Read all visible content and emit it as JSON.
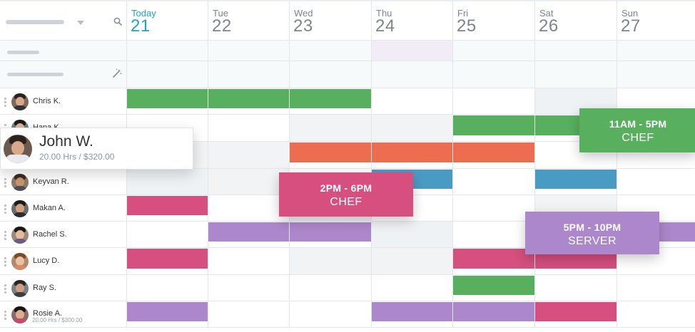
{
  "days": [
    {
      "name": "Today",
      "num": "21",
      "today": true
    },
    {
      "name": "Tue",
      "num": "22"
    },
    {
      "name": "Wed",
      "num": "23"
    },
    {
      "name": "Thu",
      "num": "24"
    },
    {
      "name": "Fri",
      "num": "25"
    },
    {
      "name": "Sat",
      "num": "26"
    },
    {
      "name": "Sun",
      "num": "27"
    }
  ],
  "employees": [
    {
      "name": "Chris K.",
      "sub": ""
    },
    {
      "name": "Hana K.",
      "sub": ""
    },
    {
      "name": "John W.",
      "sub": ""
    },
    {
      "name": "Keyvan R.",
      "sub": ""
    },
    {
      "name": "Makan A.",
      "sub": ""
    },
    {
      "name": "Rachel S.",
      "sub": ""
    },
    {
      "name": "Lucy D.",
      "sub": ""
    },
    {
      "name": "Ray S.",
      "sub": ""
    },
    {
      "name": "Rosie A.",
      "sub": "20.00 Hrs / $300.00"
    }
  ],
  "colors": {
    "green": "#58b05e",
    "orange": "#ec6d50",
    "blue": "#4a9bc4",
    "pink": "#d64f7e",
    "purple": "#ad87cb",
    "today": "#1fa3c8"
  },
  "shifts": [
    {
      "employee": 0,
      "days": [
        0,
        1,
        2
      ],
      "color": "green"
    },
    {
      "employee": 1,
      "days": [
        4,
        5,
        6
      ],
      "color": "green"
    },
    {
      "employee": 2,
      "days": [
        2,
        3,
        4
      ],
      "color": "orange"
    },
    {
      "employee": 3,
      "days": [
        3
      ],
      "color": "blue"
    },
    {
      "employee": 3,
      "days": [
        5
      ],
      "color": "blue"
    },
    {
      "employee": 4,
      "days": [
        0
      ],
      "color": "pink"
    },
    {
      "employee": 5,
      "days": [
        1,
        2
      ],
      "color": "purple"
    },
    {
      "employee": 5,
      "days": [
        6
      ],
      "color": "purple"
    },
    {
      "employee": 6,
      "days": [
        0
      ],
      "color": "pink"
    },
    {
      "employee": 6,
      "days": [
        4,
        5
      ],
      "color": "pink"
    },
    {
      "employee": 7,
      "days": [
        4
      ],
      "color": "green"
    },
    {
      "employee": 8,
      "days": [
        0
      ],
      "color": "purple"
    },
    {
      "employee": 8,
      "days": [
        3,
        4
      ],
      "color": "purple"
    },
    {
      "employee": 8,
      "days": [
        5
      ],
      "color": "pink"
    }
  ],
  "drag_card": {
    "name": "John W.",
    "sub": "20.00 Hrs / $320.00"
  },
  "float_shifts": [
    {
      "time": "11AM - 5PM",
      "role": "CHEF",
      "color": "green"
    },
    {
      "time": "2PM - 6PM",
      "role": "CHEF",
      "color": "pink"
    },
    {
      "time": "5PM - 10PM",
      "role": "SERVER",
      "color": "purple"
    }
  ]
}
